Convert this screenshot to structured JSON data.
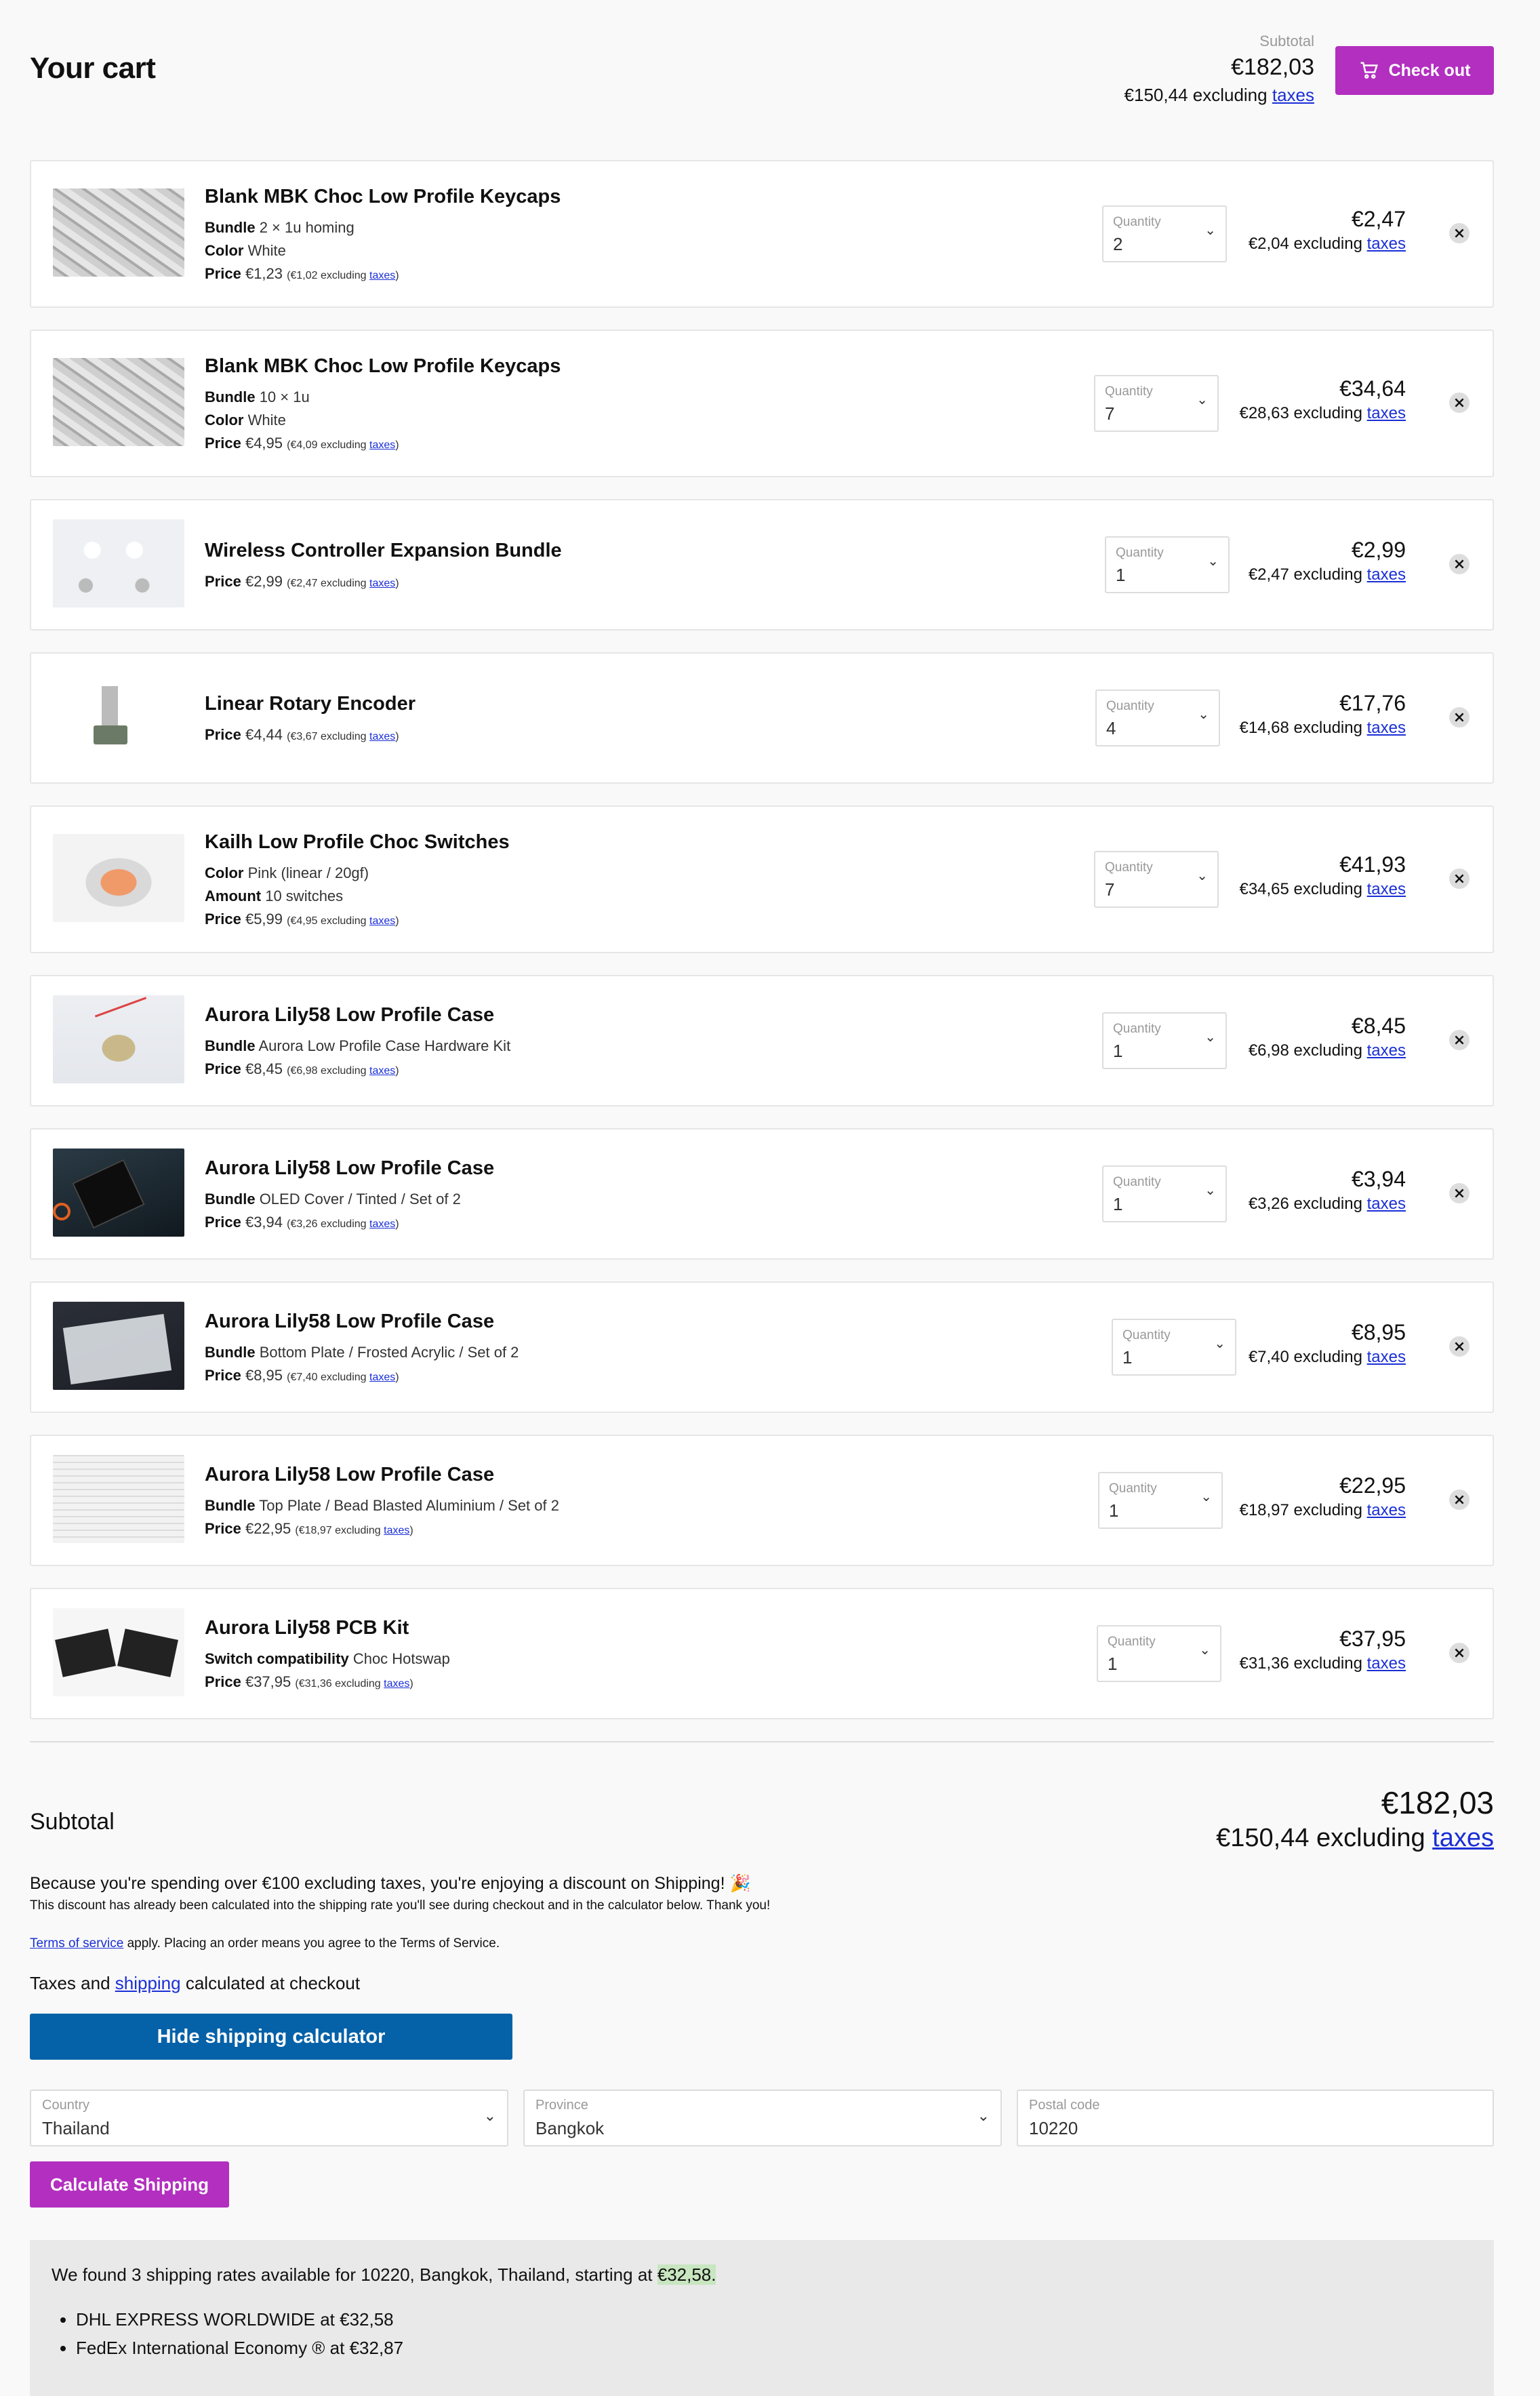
{
  "header": {
    "title": "Your cart",
    "subtotal_label": "Subtotal",
    "subtotal": "€182,03",
    "subtotal_ex_prefix": "€150,44 excluding",
    "taxes_link": "taxes",
    "checkout_label": "Check out"
  },
  "common": {
    "quantity_label": "Quantity",
    "excluding": "excluding",
    "taxes": "taxes"
  },
  "items": [
    {
      "name": "Blank MBK Choc Low Profile Keycaps",
      "opt1_k": "Bundle",
      "opt1_v": "2 × 1u homing",
      "opt2_k": "Color",
      "opt2_v": "White",
      "price_k": "Price",
      "price_v": "€1,23",
      "price_ex": "(€1,02 excluding",
      "qty": "2",
      "total": "€2,47",
      "total_ex": "€2,04 excluding"
    },
    {
      "name": "Blank MBK Choc Low Profile Keycaps",
      "opt1_k": "Bundle",
      "opt1_v": "10 × 1u",
      "opt2_k": "Color",
      "opt2_v": "White",
      "price_k": "Price",
      "price_v": "€4,95",
      "price_ex": "(€4,09 excluding",
      "qty": "7",
      "total": "€34,64",
      "total_ex": "€28,63 excluding"
    },
    {
      "name": "Wireless Controller Expansion Bundle",
      "price_k": "Price",
      "price_v": "€2,99",
      "price_ex": "(€2,47 excluding",
      "qty": "1",
      "total": "€2,99",
      "total_ex": "€2,47 excluding"
    },
    {
      "name": "Linear Rotary Encoder",
      "price_k": "Price",
      "price_v": "€4,44",
      "price_ex": "(€3,67 excluding",
      "qty": "4",
      "total": "€17,76",
      "total_ex": "€14,68 excluding"
    },
    {
      "name": "Kailh Low Profile Choc Switches",
      "opt1_k": "Color",
      "opt1_v": "Pink (linear / 20gf)",
      "opt2_k": "Amount",
      "opt2_v": "10 switches",
      "price_k": "Price",
      "price_v": "€5,99",
      "price_ex": "(€4,95 excluding",
      "qty": "7",
      "total": "€41,93",
      "total_ex": "€34,65 excluding"
    },
    {
      "name": "Aurora Lily58 Low Profile Case",
      "opt1_k": "Bundle",
      "opt1_v": "Aurora Low Profile Case Hardware Kit",
      "price_k": "Price",
      "price_v": "€8,45",
      "price_ex": "(€6,98 excluding",
      "qty": "1",
      "total": "€8,45",
      "total_ex": "€6,98 excluding"
    },
    {
      "name": "Aurora Lily58 Low Profile Case",
      "opt1_k": "Bundle",
      "opt1_v": "OLED Cover / Tinted / Set of 2",
      "price_k": "Price",
      "price_v": "€3,94",
      "price_ex": "(€3,26 excluding",
      "qty": "1",
      "total": "€3,94",
      "total_ex": "€3,26 excluding"
    },
    {
      "name": "Aurora Lily58 Low Profile Case",
      "opt1_k": "Bundle",
      "opt1_v": "Bottom Plate / Frosted Acrylic / Set of 2",
      "price_k": "Price",
      "price_v": "€8,95",
      "price_ex": "(€7,40 excluding",
      "qty": "1",
      "total": "€8,95",
      "total_ex": "€7,40 excluding"
    },
    {
      "name": "Aurora Lily58 Low Profile Case",
      "opt1_k": "Bundle",
      "opt1_v": "Top Plate / Bead Blasted Aluminium / Set of 2",
      "price_k": "Price",
      "price_v": "€22,95",
      "price_ex": "(€18,97 excluding",
      "qty": "1",
      "total": "€22,95",
      "total_ex": "€18,97 excluding"
    },
    {
      "name": "Aurora Lily58 PCB Kit",
      "opt1_k": "Switch compatibility",
      "opt1_v": "Choc Hotswap",
      "price_k": "Price",
      "price_v": "€37,95",
      "price_ex": "(€31,36 excluding",
      "qty": "1",
      "total": "€37,95",
      "total_ex": "€31,36 excluding"
    }
  ],
  "footer": {
    "subtotal_label": "Subtotal",
    "subtotal": "€182,03",
    "subtotal_ex_prefix": "€150,44 excluding",
    "taxes_link": "taxes",
    "discount_msg": "Because you're spending over €100 excluding taxes, you're enjoying a discount on Shipping! 🎉",
    "discount_note": "This discount has already been calculated into the shipping rate you'll see during checkout and in the calculator below. Thank you!",
    "tos_link": "Terms of service",
    "tos_rest": " apply. Placing an order means you agree to the Terms of Service.",
    "taxes_prefix": "Taxes and ",
    "shipping_link": "shipping",
    "taxes_suffix": " calculated at checkout",
    "hide_calc_label": "Hide shipping calculator",
    "country_label": "Country",
    "country_value": "Thailand",
    "province_label": "Province",
    "province_value": "Bangkok",
    "postal_label": "Postal code",
    "postal_value": "10220",
    "calc_button": "Calculate Shipping",
    "rates_msg": "We found 3 shipping rates available for 10220, Bangkok, Thailand, starting at ",
    "rates_start": "€32,58.",
    "rates": [
      "DHL EXPRESS WORLDWIDE at €32,58",
      "FedEx International Economy ® at €32,87"
    ]
  },
  "colors": {
    "accent": "#b22fbf",
    "calc_button": "#0561a8",
    "link": "#1a2fd6",
    "highlight": "#c8e6c0"
  }
}
